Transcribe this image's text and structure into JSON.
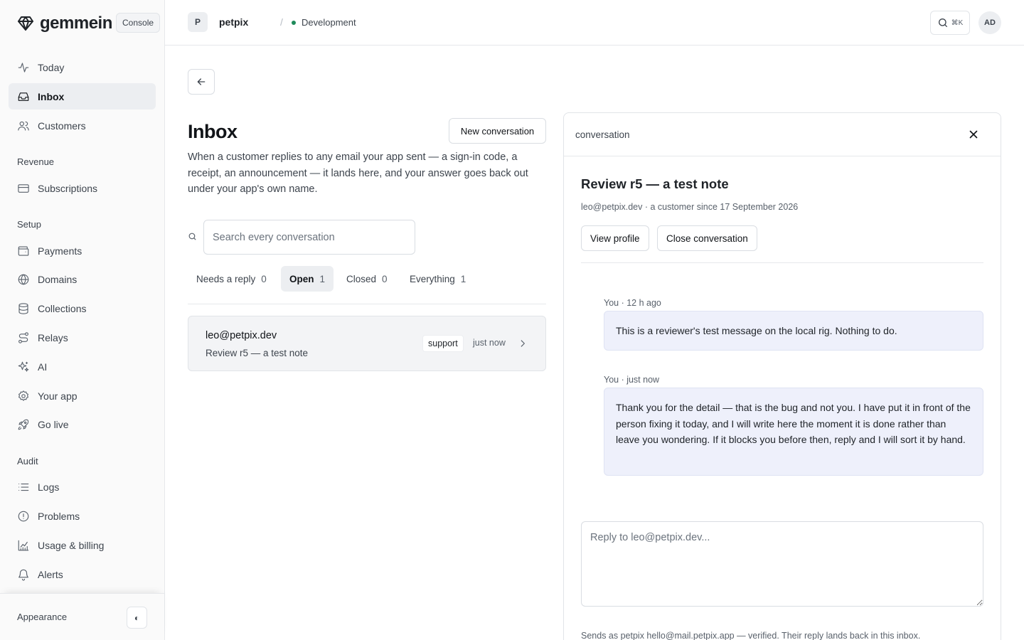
{
  "brand": {
    "name": "gemmein",
    "console_label": "Console"
  },
  "sidebar": {
    "primary": [
      {
        "label": "Today",
        "icon": "activity-icon"
      },
      {
        "label": "Inbox",
        "icon": "inbox-icon",
        "active": true
      },
      {
        "label": "Customers",
        "icon": "users-icon"
      }
    ],
    "sections": [
      {
        "title": "Revenue",
        "items": [
          {
            "label": "Subscriptions",
            "icon": "credit-card-icon"
          }
        ]
      },
      {
        "title": "Setup",
        "items": [
          {
            "label": "Payments",
            "icon": "wallet-icon"
          },
          {
            "label": "Domains",
            "icon": "globe-icon"
          },
          {
            "label": "Collections",
            "icon": "database-icon"
          },
          {
            "label": "Relays",
            "icon": "route-icon"
          },
          {
            "label": "AI",
            "icon": "sparkles-icon"
          },
          {
            "label": "Your app",
            "icon": "gear-icon"
          },
          {
            "label": "Go live",
            "icon": "rocket-icon"
          }
        ]
      },
      {
        "title": "Audit",
        "items": [
          {
            "label": "Logs",
            "icon": "list-icon"
          },
          {
            "label": "Problems",
            "icon": "alert-circle-icon"
          },
          {
            "label": "Usage & billing",
            "icon": "chart-icon"
          },
          {
            "label": "Alerts",
            "icon": "bell-icon"
          }
        ]
      }
    ],
    "footer": {
      "appearance_label": "Appearance",
      "theme_toggle_glyph": "◐"
    }
  },
  "topbar": {
    "project_initial": "P",
    "project_name": "petpix",
    "separator": "/",
    "environment": "Development",
    "environment_color": "#1f8a5a",
    "search_shortcut": "⌘K",
    "user_initials": "AD"
  },
  "inbox": {
    "title": "Inbox",
    "new_conversation_label": "New conversation",
    "description": "When a customer replies to any email your app sent — a sign-in code, a receipt, an announcement — it lands here, and your answer goes back out under your app's own name.",
    "search_placeholder": "Search every conversation",
    "tabs": [
      {
        "label": "Needs a reply",
        "count": "0"
      },
      {
        "label": "Open",
        "count": "1",
        "active": true
      },
      {
        "label": "Closed",
        "count": "0"
      },
      {
        "label": "Everything",
        "count": "1"
      }
    ],
    "conversations": [
      {
        "email": "leo@petpix.dev",
        "subject": "Review r5 — a test note",
        "tag": "support",
        "time": "just now"
      }
    ]
  },
  "panel": {
    "label": "conversation",
    "title": "Review r5 — a test note",
    "meta": "leo@petpix.dev · a customer since 17 September 2026",
    "view_profile_label": "View profile",
    "close_conversation_label": "Close conversation",
    "messages": [
      {
        "meta": "You · 12 h ago",
        "body": "This is a reviewer's test message on the local rig. Nothing to do."
      },
      {
        "meta": "You · just now",
        "body": "Thank you for the detail — that is the bug and not you. I have put it in front of the person fixing it today, and I will write here the moment it is done rather than leave you wondering. If it blocks you before then, reply and I will sort it by hand."
      }
    ],
    "reply_placeholder": "Reply to leo@petpix.dev...",
    "sends_note": "Sends as petpix hello@mail.petpix.app — verified. Their reply lands back in this inbox."
  }
}
